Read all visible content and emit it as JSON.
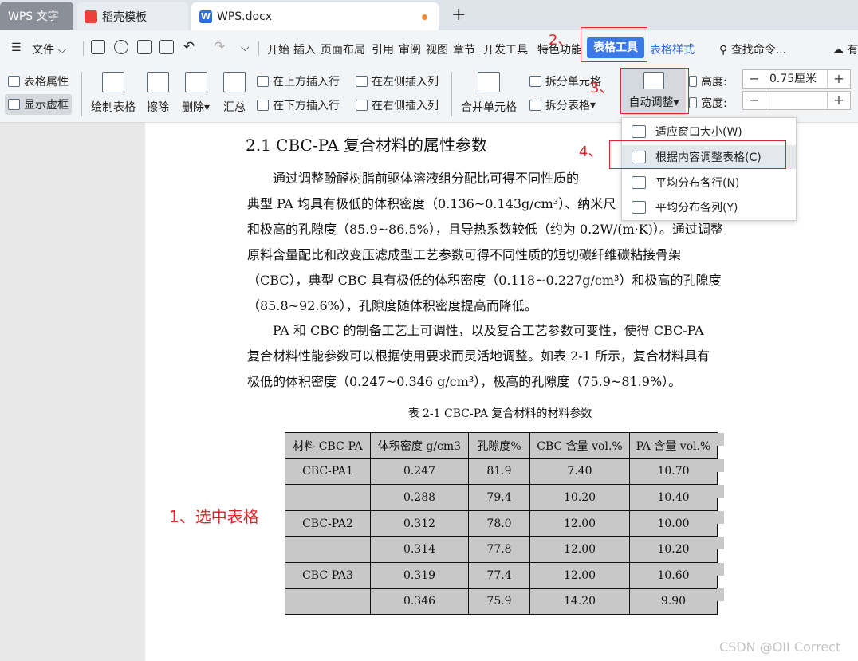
{
  "tabs": [
    {
      "label": "WPS 文字"
    },
    {
      "label": "稻壳模板"
    },
    {
      "label": "WPS.docx"
    }
  ],
  "menu": {
    "file": "文件",
    "items": [
      "开始",
      "插入",
      "页面布局",
      "引用",
      "审阅",
      "视图",
      "章节",
      "开发工具",
      "特色功能"
    ],
    "table_tools": "表格工具",
    "table_style": "表格样式",
    "search": "查找命令...",
    "cut_off": "有"
  },
  "ribbon": {
    "table_props": "表格属性",
    "show_grid": "显示虚框",
    "draw_table": "绘制表格",
    "erase": "擦除",
    "delete": "删除",
    "summary": "汇总",
    "insert_above": "在上方插入行",
    "insert_below": "在下方插入行",
    "insert_left": "在左侧插入列",
    "insert_right": "在右侧插入列",
    "merge_cells": "合并单元格",
    "split_cells": "拆分单元格",
    "split_table": "拆分表格",
    "auto_fit": "自动调整",
    "height_label": "高度:",
    "height_value": "0.75厘米",
    "width_label": "宽度:",
    "width_value": ""
  },
  "dropdown": [
    {
      "label": "适应窗口大小(W)"
    },
    {
      "label": "根据内容调整表格(C)"
    },
    {
      "label": "平均分布各行(N)"
    },
    {
      "label": "平均分布各列(Y)"
    }
  ],
  "annotations": {
    "step1": "1、选中表格",
    "step2": "2、",
    "step3": "3、",
    "step4": "4、",
    "color": "#e0262d"
  },
  "doc": {
    "heading": "2.1  CBC-PA 复合材料的属性参数",
    "p1": [
      "通过调整酚醛树脂前驱体溶液组分配比可得不同性质的",
      "典型 PA 均具有极低的体积密度（0.136~0.143g/cm³）、纳米尺",
      "和极高的孔隙度（85.9~86.5%），且导热系数较低（约为 0.2W/(m·K)）。通过调整",
      "原料含量配比和改变压滤成型工艺参数可得不同性质的短切碳纤维碳粘接骨架",
      "（CBC），典型 CBC 具有极低的体积密度（0.118~0.227g/cm³）和极高的孔隙度",
      "（85.8~92.6%），孔隙度随体积密度提高而降低。"
    ],
    "p2": [
      "PA 和 CBC 的制备工艺上可调性，以及复合工艺参数可变性，使得 CBC-PA",
      "复合材料性能参数可以根据使用要求而灵活地调整。如表 2-1 所示，复合材料具有",
      "极低的体积密度（0.247~0.346 g/cm³），极高的孔隙度（75.9~81.9%）。"
    ],
    "caption": "表 2-1 CBC-PA 复合材料的材料参数"
  },
  "table": {
    "headers": [
      "材料 CBC-PA",
      "体积密度 g/cm3",
      "孔隙度%",
      "CBC 含量 vol.%",
      "PA 含量 vol.%"
    ],
    "rows": [
      [
        "CBC-PA1",
        "0.247",
        "81.9",
        "7.40",
        "10.70"
      ],
      [
        "",
        "0.288",
        "79.4",
        "10.20",
        "10.40"
      ],
      [
        "CBC-PA2",
        "0.312",
        "78.0",
        "12.00",
        "10.00"
      ],
      [
        "",
        "0.314",
        "77.8",
        "12.00",
        "10.20"
      ],
      [
        "CBC-PA3",
        "0.319",
        "77.4",
        "12.00",
        "10.60"
      ],
      [
        "",
        "0.346",
        "75.9",
        "14.20",
        "9.90"
      ]
    ]
  },
  "watermark": "CSDN @OII Correct"
}
